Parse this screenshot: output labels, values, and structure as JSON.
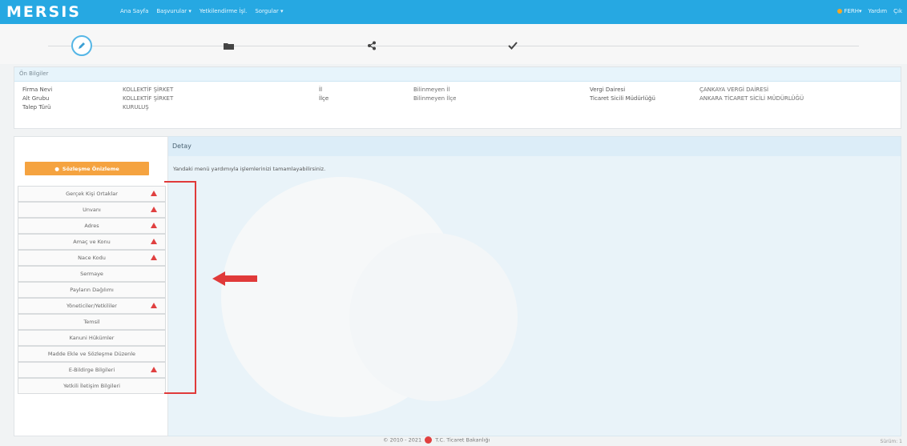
{
  "header": {
    "logo": "MERSIS",
    "nav": [
      "Ana Sayfa",
      "Başvurular ▾",
      "Yetkilendirme İşl.",
      "Sorgular ▾"
    ],
    "right": [
      "FERH▾",
      "Yardım",
      "Çık"
    ]
  },
  "steps": {
    "icons": [
      "pencil-icon",
      "folder-icon",
      "share-icon",
      "check-icon"
    ]
  },
  "pre_info": {
    "title": "Ön Bilgiler",
    "rows": [
      {
        "label": "Firma Nevi",
        "value": "KOLLEKTİF ŞİRKET"
      },
      {
        "label": "Alt Grubu",
        "value": "KOLLEKTİF ŞİRKET"
      },
      {
        "label": "Talep Türü",
        "value": "KURULUŞ"
      }
    ],
    "mid": [
      {
        "label": "İl",
        "value": "Bilinmeyen İl"
      },
      {
        "label": "İlçe",
        "value": "Bilinmeyen İlçe"
      }
    ],
    "right": [
      {
        "label": "Vergi Dairesi",
        "value": "ÇANKAYA VERGİ DAİRESİ"
      },
      {
        "label": "Ticaret Sicili Müdürlüğü",
        "value": "ANKARA TİCARET SİCİLİ MÜDÜRLÜĞÜ"
      }
    ]
  },
  "sidebar": {
    "preview_button": "Sözleşme Önizleme",
    "items": [
      {
        "label": "Gerçek Kişi Ortaklar",
        "warning": true
      },
      {
        "label": "Unvanı",
        "warning": true
      },
      {
        "label": "Adres",
        "warning": true
      },
      {
        "label": "Amaç ve Konu",
        "warning": true
      },
      {
        "label": "Nace Kodu",
        "warning": true
      },
      {
        "label": "Sermaye",
        "warning": false
      },
      {
        "label": "Payların Dağılımı",
        "warning": false
      },
      {
        "label": "Yöneticiler/Yetkililer",
        "warning": true
      },
      {
        "label": "Temsil",
        "warning": false
      },
      {
        "label": "Kanuni Hükümler",
        "warning": false
      },
      {
        "label": "Madde Ekle ve Sözleşme Düzenle",
        "warning": false
      },
      {
        "label": "E-Bildirge Bilgileri",
        "warning": true
      },
      {
        "label": "Yetkili İletişim Bilgileri",
        "warning": false
      }
    ]
  },
  "detail": {
    "title": "Detay",
    "text": "Yandaki menü yardımıyla işlemlerinizi tamamlayabilirsiniz."
  },
  "footer": {
    "copyright": "© 2010 - 2021",
    "ministry": "T.C. Ticaret Bakanlığı",
    "version": "Sürüm: 1"
  },
  "colors": {
    "nav": "#26a8e2",
    "orange": "#f5a340",
    "warning": "#e04040",
    "annotation": "#e03a3a"
  }
}
